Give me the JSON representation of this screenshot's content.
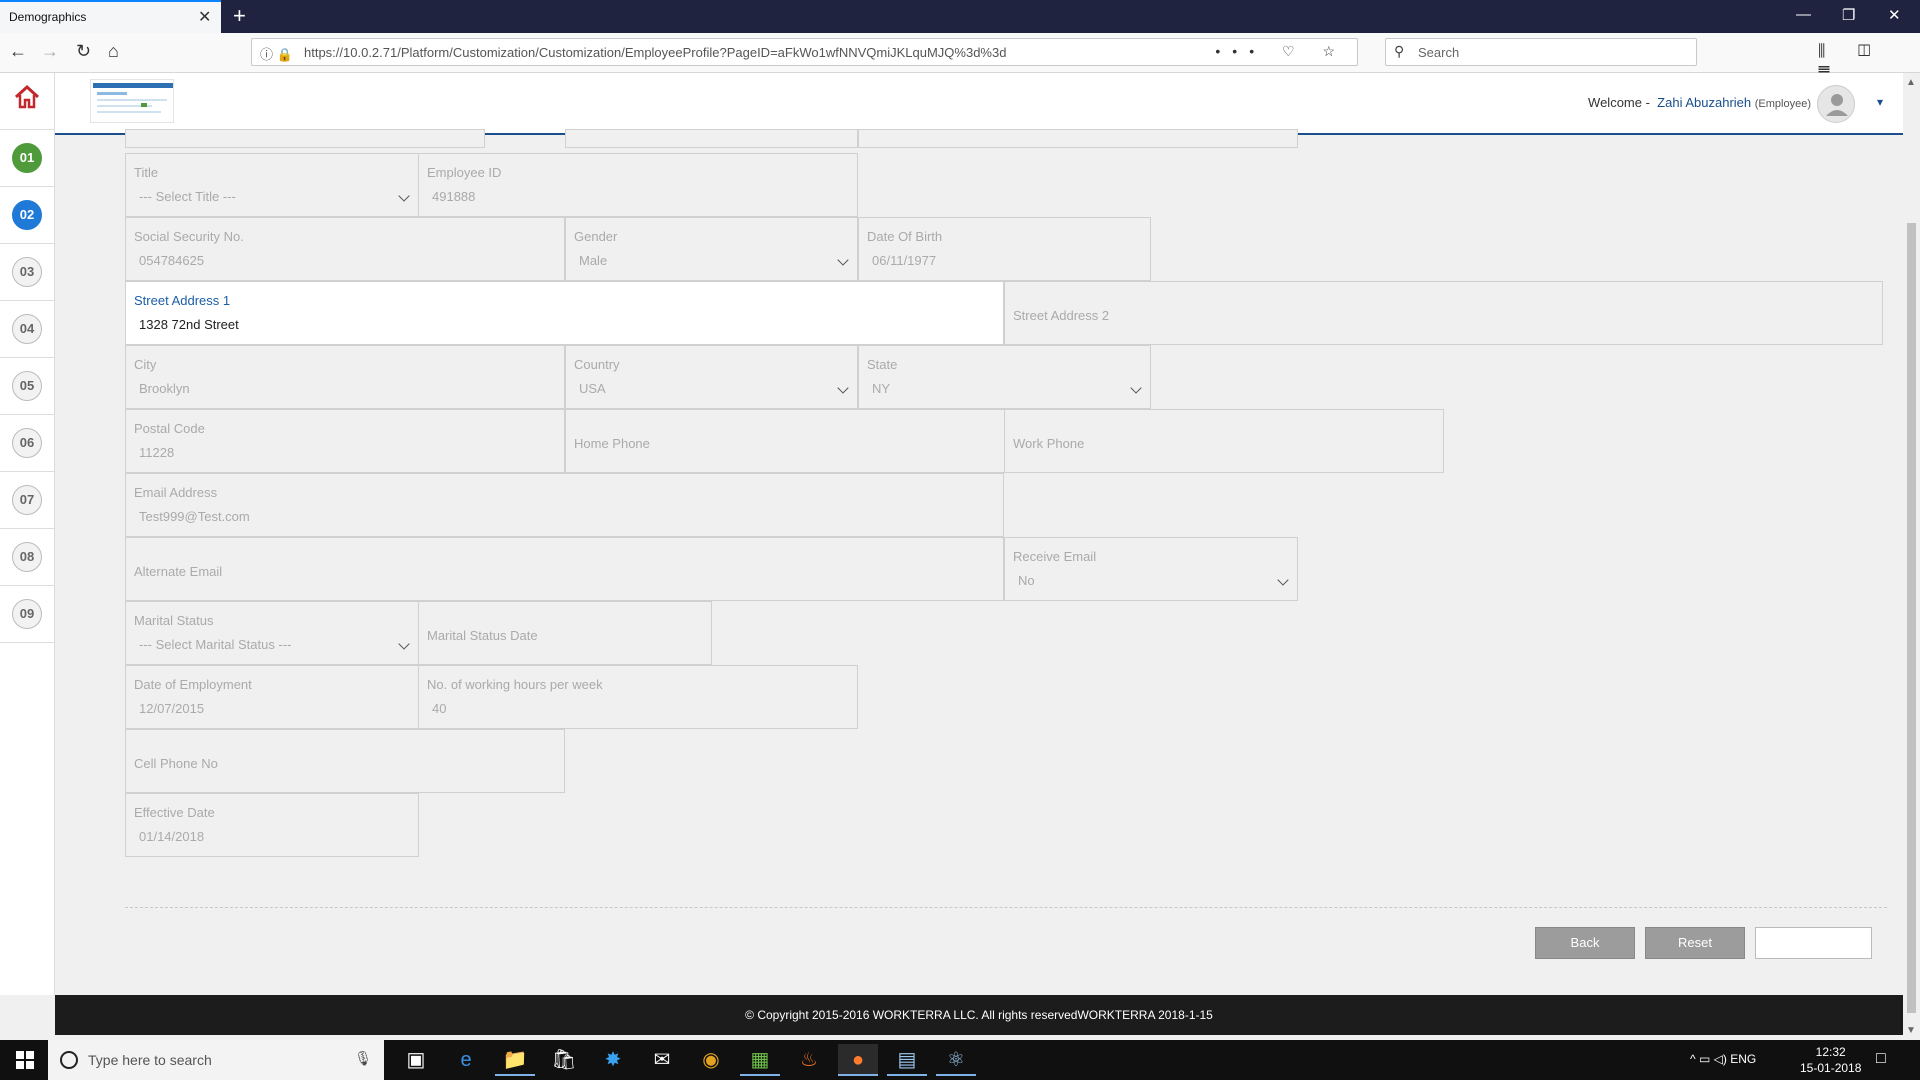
{
  "browser": {
    "tab_title": "Demographics",
    "tab_close": "✕",
    "new_tab": "+",
    "url": "https://10.0.2.71/Platform/Customization/Customization/EmployeeProfile?PageID=aFkWo1wfNNVQmiJKLquMJQ%3d%3d",
    "url_actions": "••• ♡ ☆",
    "search_placeholder": "Search",
    "window_controls": [
      "—",
      "❐",
      "✕"
    ],
    "toolbar_right": "⫼ ◫ ☰"
  },
  "header": {
    "welcome_prefix": "Welcome -",
    "user_name": "Zahi Abuzahrieh",
    "user_role": "(Employee)",
    "dropdown": "▾"
  },
  "sidebar": {
    "steps": [
      {
        "label": "01",
        "state": "done"
      },
      {
        "label": "02",
        "state": "current"
      },
      {
        "label": "03",
        "state": "pending"
      },
      {
        "label": "04",
        "state": "pending"
      },
      {
        "label": "05",
        "state": "pending"
      },
      {
        "label": "06",
        "state": "pending"
      },
      {
        "label": "07",
        "state": "pending"
      },
      {
        "label": "08",
        "state": "pending"
      },
      {
        "label": "09",
        "state": "pending"
      }
    ]
  },
  "form": {
    "title": {
      "label": "Title",
      "value": "--- Select Title ---"
    },
    "employee_id": {
      "label": "Employee ID",
      "value": "491888"
    },
    "ssn": {
      "label": "Social Security No.",
      "value": "054784625"
    },
    "gender": {
      "label": "Gender",
      "value": "Male"
    },
    "dob": {
      "label": "Date Of Birth",
      "value": "06/11/1977"
    },
    "street1": {
      "label": "Street Address 1",
      "value": "1328 72nd Street"
    },
    "street2": {
      "label": "Street Address 2"
    },
    "city": {
      "label": "City",
      "value": "Brooklyn"
    },
    "country": {
      "label": "Country",
      "value": "USA"
    },
    "state": {
      "label": "State",
      "value": "NY"
    },
    "postal_code": {
      "label": "Postal Code",
      "value": "11228"
    },
    "home_phone": {
      "label": "Home Phone"
    },
    "work_phone": {
      "label": "Work Phone"
    },
    "email": {
      "label": "Email Address",
      "value": "Test999@Test.com"
    },
    "alt_email": {
      "label": "Alternate Email"
    },
    "receive_email": {
      "label": "Receive Email",
      "value": "No"
    },
    "marital_status": {
      "label": "Marital Status",
      "value": "--- Select Marital Status ---"
    },
    "marital_date": {
      "label": "Marital Status Date"
    },
    "employment_date": {
      "label": "Date of Employment",
      "value": "12/07/2015"
    },
    "working_hours": {
      "label": "No. of working hours per week",
      "value": "40"
    },
    "cell_phone": {
      "label": "Cell Phone No"
    },
    "effective_date": {
      "label": "Effective Date",
      "value": "01/14/2018"
    }
  },
  "buttons": {
    "back": "Back",
    "reset": "Reset",
    "next": ""
  },
  "footer": {
    "copyright": "© Copyright 2015-2016 WORKTERRA LLC. All rights reservedWORKTERRA 2018-1-15"
  },
  "taskbar": {
    "search_placeholder": "Type here to search",
    "tray": "^  ▭  ◁)  ENG",
    "time": "12:32",
    "date": "15-01-2018"
  },
  "colors": {
    "accent_blue": "#1a4f8b",
    "step_done": "#4f9a3b",
    "step_current": "#1e7ad6"
  }
}
